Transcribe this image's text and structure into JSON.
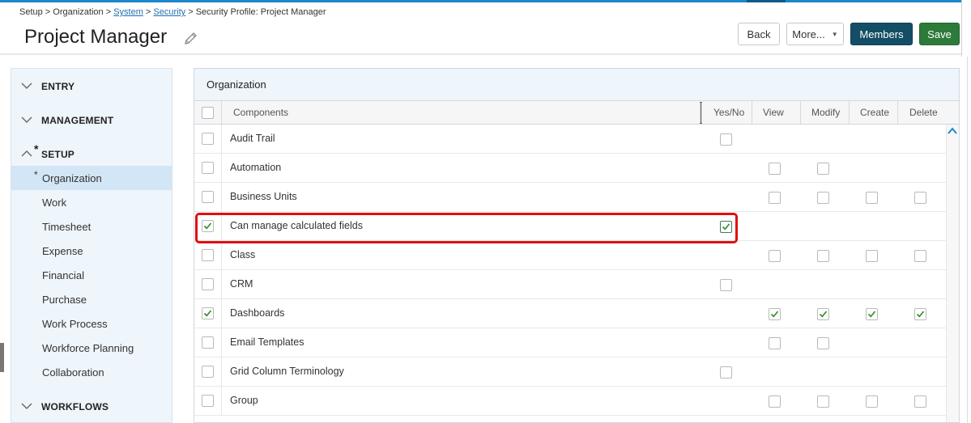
{
  "breadcrumb": {
    "part1": "Setup > Organization > ",
    "system": "System",
    "sep1": " > ",
    "security": "Security",
    "sep2": " > Security Profile: Project Manager"
  },
  "page": {
    "title": "Project Manager"
  },
  "toolbar": {
    "back": "Back",
    "more": "More...",
    "members": "Members",
    "save": "Save"
  },
  "colors": {
    "accent": "#1b87c9",
    "members": "#134e66",
    "save": "#2d7a3a",
    "highlight": "#e01010",
    "check": "#3a8a2e"
  },
  "sidebar": {
    "groups": {
      "entry": "ENTRY",
      "management": "MANAGEMENT",
      "setup": "SETUP",
      "workflows": "WORKFLOWS"
    },
    "asterisk": "*",
    "items": [
      "Organization",
      "Work",
      "Timesheet",
      "Expense",
      "Financial",
      "Purchase",
      "Work Process",
      "Workforce Planning",
      "Collaboration"
    ],
    "selected": "Organization"
  },
  "panel": {
    "title": "Organization",
    "columns": {
      "components": "Components",
      "yesno": "Yes/No",
      "view": "View",
      "modify": "Modify",
      "create": "Create",
      "delete": "Delete"
    },
    "rows": [
      {
        "name": "Audit Trail",
        "selected": false,
        "yesno": false,
        "view": null,
        "modify": null,
        "create": null,
        "delete": null
      },
      {
        "name": "Automation",
        "selected": false,
        "yesno": null,
        "view": false,
        "modify": false,
        "create": null,
        "delete": null
      },
      {
        "name": "Business Units",
        "selected": false,
        "yesno": null,
        "view": false,
        "modify": false,
        "create": false,
        "delete": false
      },
      {
        "name": "Can manage calculated fields",
        "selected": true,
        "yesno": true,
        "view": null,
        "modify": null,
        "create": null,
        "delete": null
      },
      {
        "name": "Class",
        "selected": false,
        "yesno": null,
        "view": false,
        "modify": false,
        "create": false,
        "delete": false
      },
      {
        "name": "CRM",
        "selected": false,
        "yesno": false,
        "view": null,
        "modify": null,
        "create": null,
        "delete": null
      },
      {
        "name": "Dashboards",
        "selected": true,
        "yesno": null,
        "view": true,
        "modify": true,
        "create": true,
        "delete": true
      },
      {
        "name": "Email Templates",
        "selected": false,
        "yesno": null,
        "view": false,
        "modify": false,
        "create": null,
        "delete": null
      },
      {
        "name": "Grid Column Terminology",
        "selected": false,
        "yesno": false,
        "view": null,
        "modify": null,
        "create": null,
        "delete": null
      },
      {
        "name": "Group",
        "selected": false,
        "yesno": null,
        "view": false,
        "modify": false,
        "create": false,
        "delete": false
      }
    ]
  }
}
